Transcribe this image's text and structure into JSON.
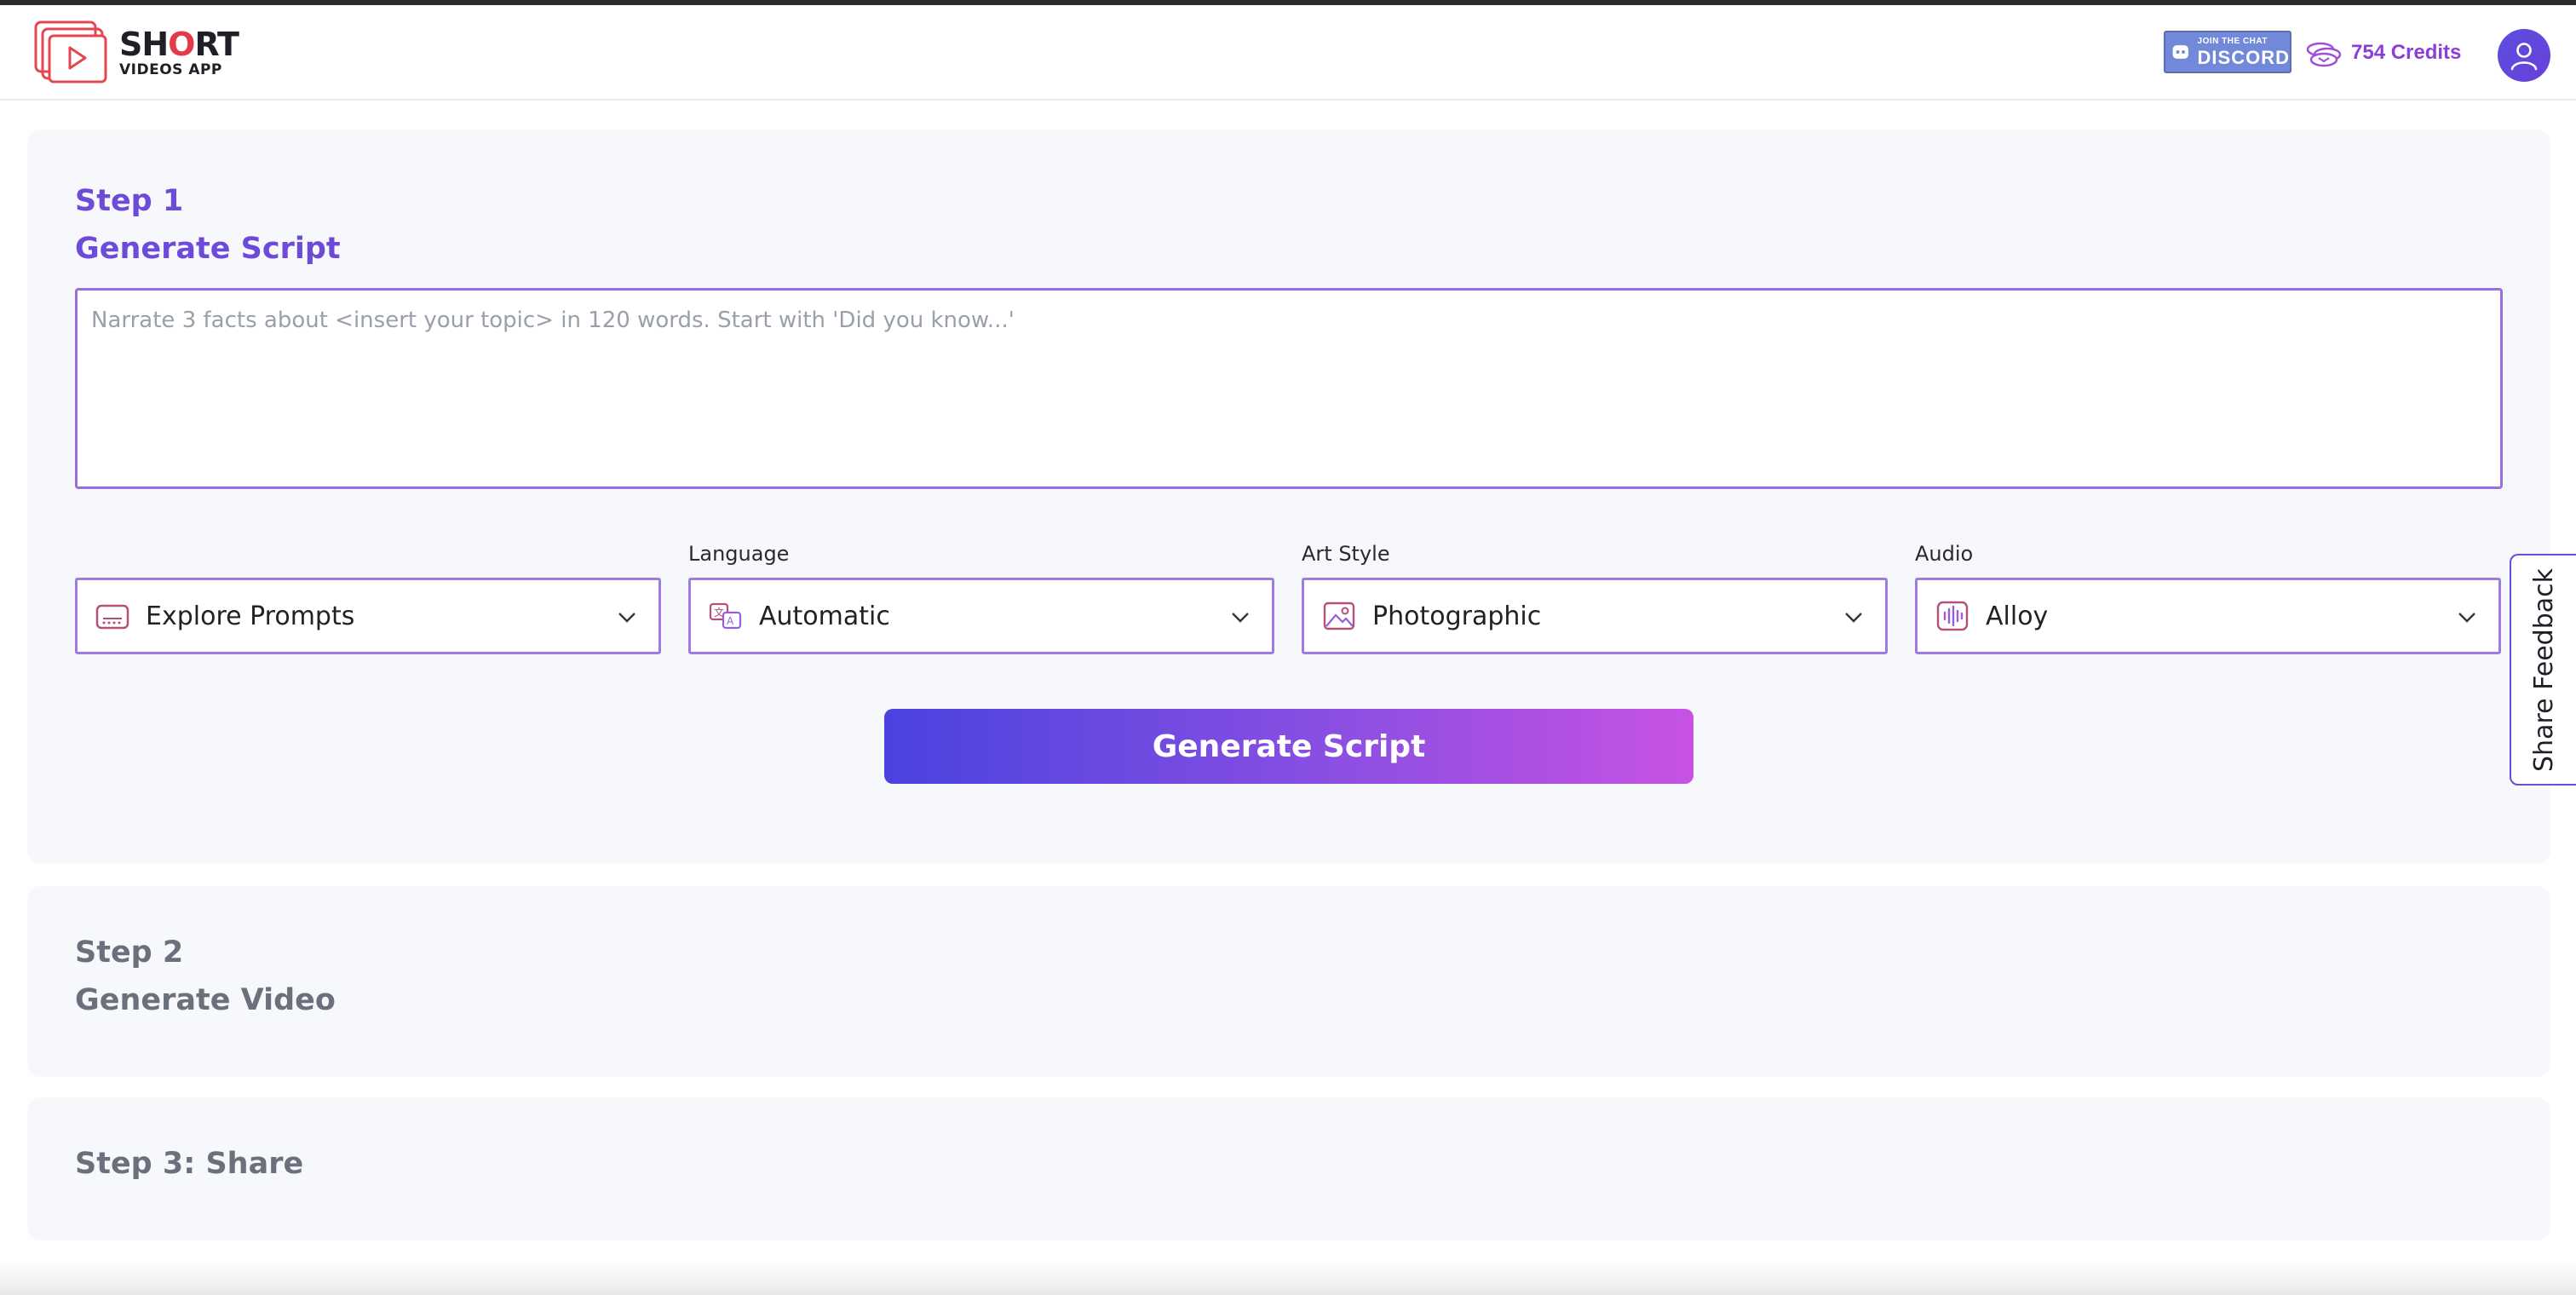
{
  "header": {
    "logo_title_pre": "SH",
    "logo_title_o": "O",
    "logo_title_post": "RT",
    "logo_sub": "VIDEOS APP",
    "discord_small": "JOIN THE CHAT",
    "discord_big": "DISCORD",
    "credits": "754 Credits"
  },
  "step1": {
    "step": "Step 1",
    "title": "Generate Script",
    "script_placeholder": "Narrate 3 facts about <insert your topic> in 120 words. Start with 'Did you know...'",
    "prompts": {
      "value": "Explore Prompts"
    },
    "language": {
      "label": "Language",
      "value": "Automatic"
    },
    "art_style": {
      "label": "Art Style",
      "value": "Photographic"
    },
    "audio": {
      "label": "Audio",
      "value": "Alloy"
    },
    "button": "Generate Script"
  },
  "step2": {
    "step": "Step 2",
    "title": "Generate Video"
  },
  "step3": {
    "title": "Step 3: Share"
  },
  "feedback": "Share Feedback",
  "colors": {
    "accent": "#6d4bd8",
    "brand_red": "#e33a4a",
    "discord": "#7289da",
    "credits": "#8b3fd8"
  }
}
